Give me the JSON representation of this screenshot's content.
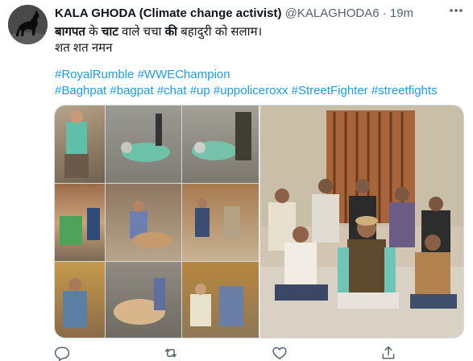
{
  "tweet": {
    "display_name": "KALA GHODA (Climate change activist)",
    "handle": "@KALAGHODA6",
    "separator": "·",
    "time": "19m",
    "text_line1_part1": "बागपत",
    "text_line1_part2": " के ",
    "text_line1_part3": "चाट",
    "text_line1_part4": " वाले चचा ",
    "text_line1_part5": "की",
    "text_line1_part6": " बहादुरी को सलाम।",
    "text_line2": "शत शत नमन",
    "hashtags_line1": [
      "#RoyalRumble",
      "#WWEChampion"
    ],
    "hashtags_line2": [
      "#Baghpat",
      "#bagpat",
      "#chat",
      "#up",
      "#uppoliceroxx",
      "#StreetFighter",
      "#streetfights"
    ]
  },
  "icons": {
    "avatar": "horse-avatar",
    "more": "more-icon",
    "reply": "reply-icon",
    "retweet": "retweet-icon",
    "like": "like-icon",
    "share": "share-icon"
  },
  "colors": {
    "link": "#1d9bf0",
    "secondary_text": "#536471",
    "text": "#0f1419",
    "border": "#cfd9de"
  }
}
